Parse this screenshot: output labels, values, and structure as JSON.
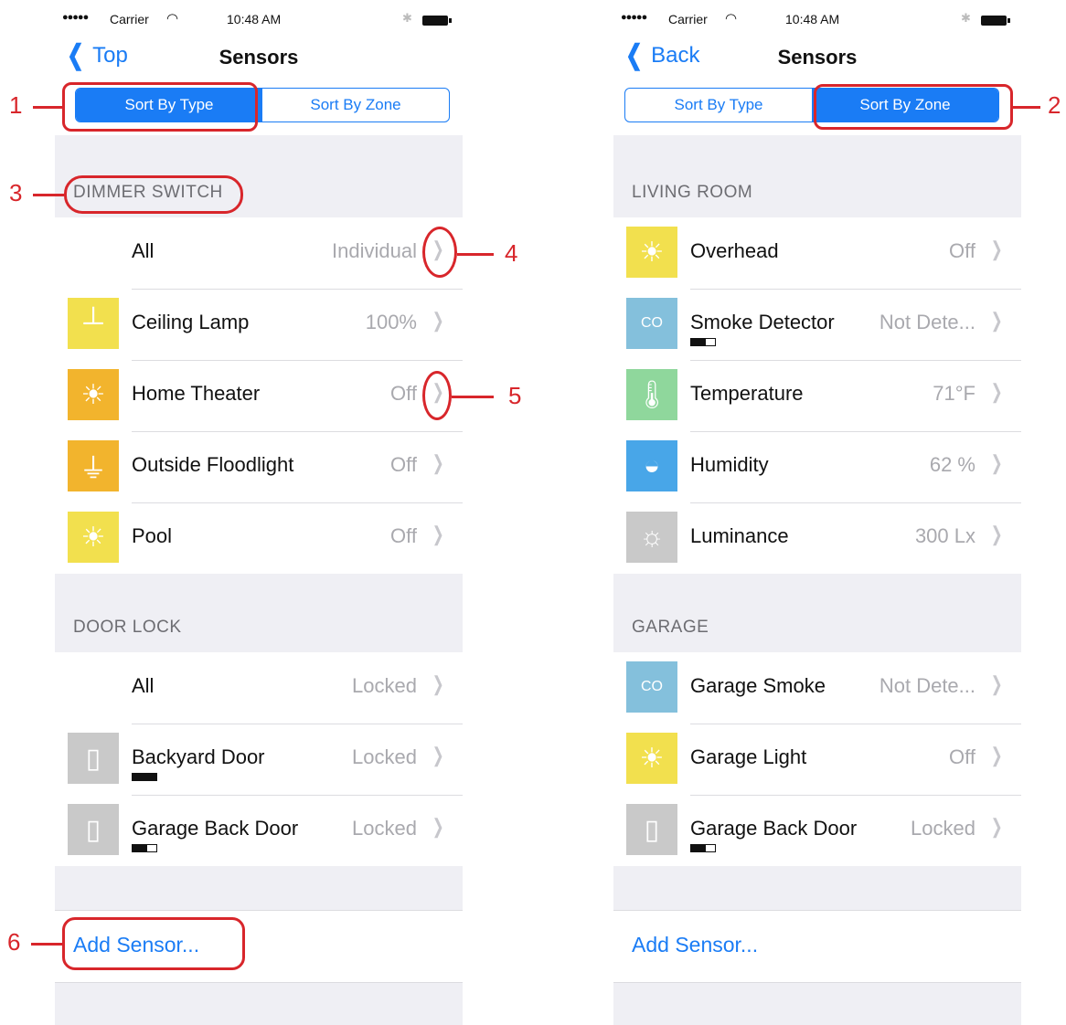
{
  "status_bar": {
    "signal": "●●●●●",
    "carrier": "Carrier",
    "time": "10:48 AM"
  },
  "screen_left": {
    "nav_back": "Top",
    "nav_title": "Sensors",
    "segments": [
      "Sort By Type",
      "Sort By Zone"
    ],
    "active_segment": 0,
    "sections": [
      {
        "header": "DIMMER SWITCH",
        "rows": [
          {
            "label": "All",
            "value": "Individual",
            "icon": "none"
          },
          {
            "label": "Ceiling Lamp",
            "value": "100%",
            "icon": "lamp-icon"
          },
          {
            "label": "Home Theater",
            "value": "Off",
            "icon": "bulb-icon"
          },
          {
            "label": "Outside Floodlight",
            "value": "Off",
            "icon": "plug-icon"
          },
          {
            "label": "Pool",
            "value": "Off",
            "icon": "bulb-icon"
          }
        ]
      },
      {
        "header": "DOOR LOCK",
        "rows": [
          {
            "label": "All",
            "value": "Locked",
            "icon": "none"
          },
          {
            "label": "Backyard Door",
            "value": "Locked",
            "icon": "door-icon",
            "battery": "full"
          },
          {
            "label": "Garage Back Door",
            "value": "Locked",
            "icon": "door-icon",
            "battery": "partial"
          }
        ]
      }
    ],
    "add_sensor": "Add Sensor..."
  },
  "screen_right": {
    "nav_back": "Back",
    "nav_title": "Sensors",
    "segments": [
      "Sort By Type",
      "Sort By Zone"
    ],
    "active_segment": 1,
    "sections": [
      {
        "header": "LIVING ROOM",
        "rows": [
          {
            "label": "Overhead",
            "value": "Off",
            "icon": "bulb-icon"
          },
          {
            "label": "Smoke Detector",
            "value": "Not Dete...",
            "icon": "smoke-icon",
            "battery": "partial"
          },
          {
            "label": "Temperature",
            "value": "71°F",
            "icon": "thermometer-icon"
          },
          {
            "label": "Humidity",
            "value": "62 %",
            "icon": "droplet-icon"
          },
          {
            "label": "Luminance",
            "value": "300 Lx",
            "icon": "sun-icon"
          }
        ]
      },
      {
        "header": "GARAGE",
        "rows": [
          {
            "label": "Garage Smoke",
            "value": "Not Dete...",
            "icon": "smoke-icon"
          },
          {
            "label": "Garage Light",
            "value": "Off",
            "icon": "bulb-icon"
          },
          {
            "label": "Garage Back Door",
            "value": "Locked",
            "icon": "door-icon",
            "battery": "partial"
          }
        ]
      }
    ],
    "add_sensor": "Add Sensor..."
  },
  "annotations": [
    "1",
    "2",
    "3",
    "4",
    "5",
    "6"
  ],
  "colors": {
    "accent": "#1a7cf5",
    "annotation": "#d8262b",
    "grouped_bg": "#efeff4"
  }
}
